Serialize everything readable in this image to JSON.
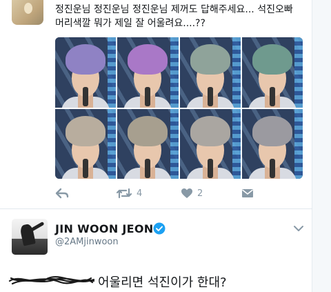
{
  "tweet1": {
    "line1": "정진운님 정진운님 정진운님 제꺼도 답해주세요... 석진오빠",
    "line2": "머리색깔 뭐가 제일 잘 어울려요....??",
    "photos": [
      {
        "hair_color": "#8f82c4"
      },
      {
        "hair_color": "#a978c7"
      },
      {
        "hair_color": "#8fa39a"
      },
      {
        "hair_color": "#6f9a8e"
      },
      {
        "hair_color": "#b8ad9e"
      },
      {
        "hair_color": "#a79f8f"
      },
      {
        "hair_color": "#aaa6a1"
      },
      {
        "hair_color": "#9b9aa0"
      }
    ],
    "actions": {
      "retweet_count": "4",
      "like_count": "2"
    }
  },
  "tweet2": {
    "name": "JIN WOON JEONG",
    "handle": "@2AMjinwoon",
    "text": "어울리면 석진이가 한대?"
  },
  "colors": {
    "verified": "#1da1f2",
    "icon_gray": "#8899a6"
  }
}
